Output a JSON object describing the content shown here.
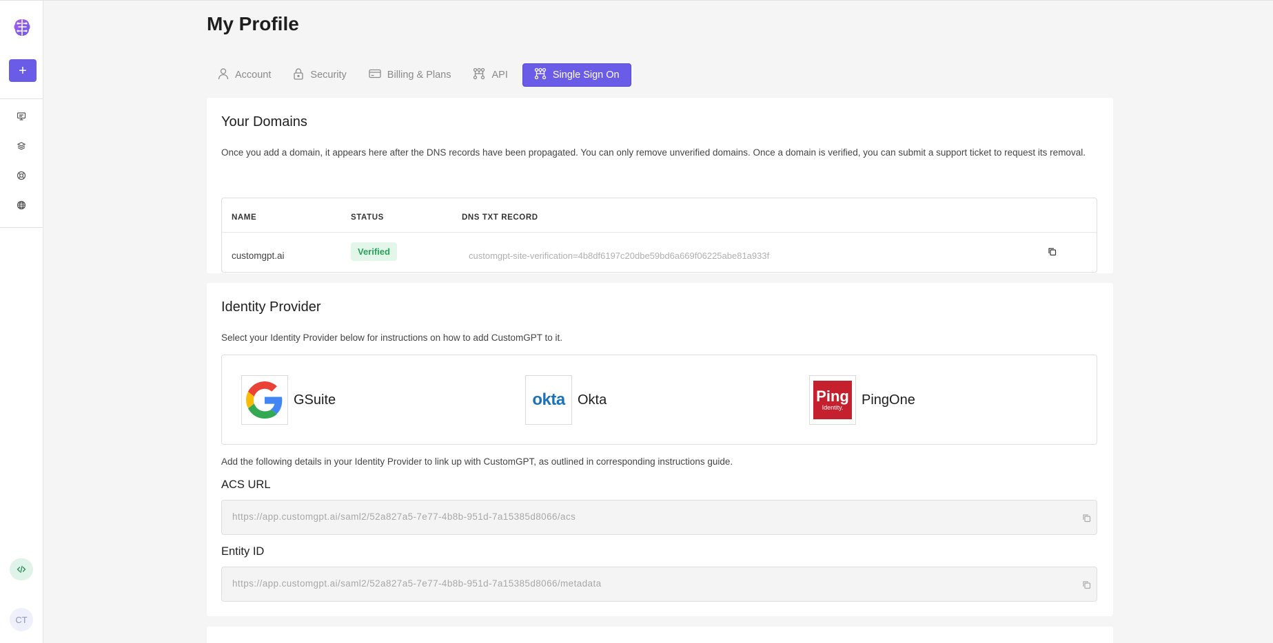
{
  "sidebar": {
    "logo_icon": "brain-logo-icon",
    "new_label": "+",
    "nav_icons": [
      "monitor-icon",
      "layers-icon",
      "lifebuoy-icon",
      "globe-icon"
    ],
    "code_icon": "code-icon",
    "avatar_initials": "CT"
  },
  "page": {
    "title": "My Profile"
  },
  "tabs": [
    {
      "label": "Account",
      "icon": "user-icon",
      "active": false
    },
    {
      "label": "Security",
      "icon": "lock-icon",
      "active": false
    },
    {
      "label": "Billing & Plans",
      "icon": "credit-card-icon",
      "active": false
    },
    {
      "label": "API",
      "icon": "api-icon",
      "active": false
    },
    {
      "label": "Single Sign On",
      "icon": "sso-icon",
      "active": true
    }
  ],
  "domains": {
    "title": "Your Domains",
    "description": "Once you add a domain, it appears here after the DNS records have been propagated. You can only remove unverified domains. Once a domain is verified, you can submit a support ticket to request its removal.",
    "columns": {
      "name": "NAME",
      "status": "STATUS",
      "dns": "DNS TXT RECORD"
    },
    "rows": [
      {
        "name": "customgpt.ai",
        "status": "Verified",
        "dns": "customgpt-site-verification=4b8df6197c20dbe59bd6a669f06225abe81a933f"
      }
    ]
  },
  "identity": {
    "title": "Identity Provider",
    "description": "Select your Identity Provider below for instructions on how to add CustomGPT to it.",
    "providers": [
      {
        "name": "GSuite",
        "icon": "google-logo-icon",
        "logo_text": ""
      },
      {
        "name": "Okta",
        "icon": "okta-logo-icon",
        "logo_text": "okta"
      },
      {
        "name": "PingOne",
        "icon": "ping-identity-logo-icon",
        "logo_text": "Ping",
        "logo_subtext": "Identity."
      }
    ],
    "details_text": "Add the following details in your Identity Provider to link up with CustomGPT, as outlined in corresponding instructions guide.",
    "acs_label": "ACS URL",
    "acs_value": "https://app.customgpt.ai/saml2/52a827a5-7e77-4b8b-951d-7a15385d8066/acs",
    "entity_label": "Entity ID",
    "entity_value": "https://app.customgpt.ai/saml2/52a827a5-7e77-4b8b-951d-7a15385d8066/metadata"
  },
  "colors": {
    "accent": "#6b5ce7",
    "verified_bg": "#e3f6ea",
    "verified_text": "#2aa35a",
    "background": "#f5f5f5"
  }
}
